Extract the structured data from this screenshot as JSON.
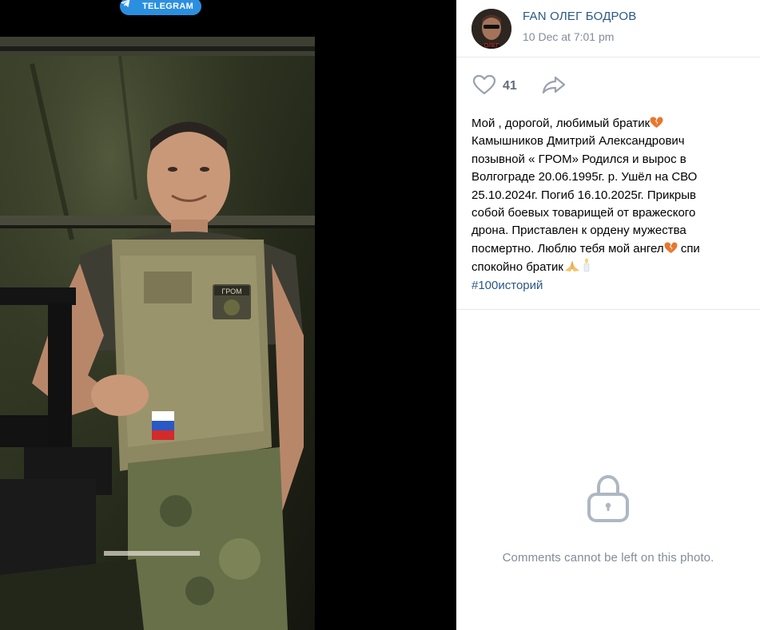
{
  "badge": {
    "label": "TELEGRAM"
  },
  "post": {
    "author": "FAN ОЛЕГ БОДРОВ",
    "date": "10 Dec at 7:01 pm",
    "likes": "41",
    "text_lines": [
      "Мой , дорогой, любимый братик",
      "Камышников Дмитрий Александрович",
      "позывной « ГРОМ» Родился и вырос в",
      "Волгограде 20.06.1995г. р. Ушёл на СВО",
      "25.10.2024г. Погиб 16.10.2025г. Прикрыв",
      "собой боевых товарищей от вражеского",
      "дрона. Приставлен к ордену мужества",
      "посмертно. Люблю тебя мой ангел",
      "спи",
      "спокойно братик"
    ],
    "hashtag": "#100историй"
  },
  "comments": {
    "closed_message": "Comments cannot be left on this photo."
  },
  "photo": {
    "patch_text": "ГРОМ"
  },
  "icons": {
    "telegram": "telegram-icon",
    "like": "heart-icon",
    "share": "share-arrow-icon",
    "lock": "lock-icon",
    "broken_heart": "broken-heart-emoji",
    "praying_hands": "praying-hands-emoji",
    "candle": "candle-emoji"
  },
  "colors": {
    "link": "#2a5885",
    "muted": "#818c99",
    "badge": "#2b8fe0",
    "broken_heart": "#e8772e"
  }
}
